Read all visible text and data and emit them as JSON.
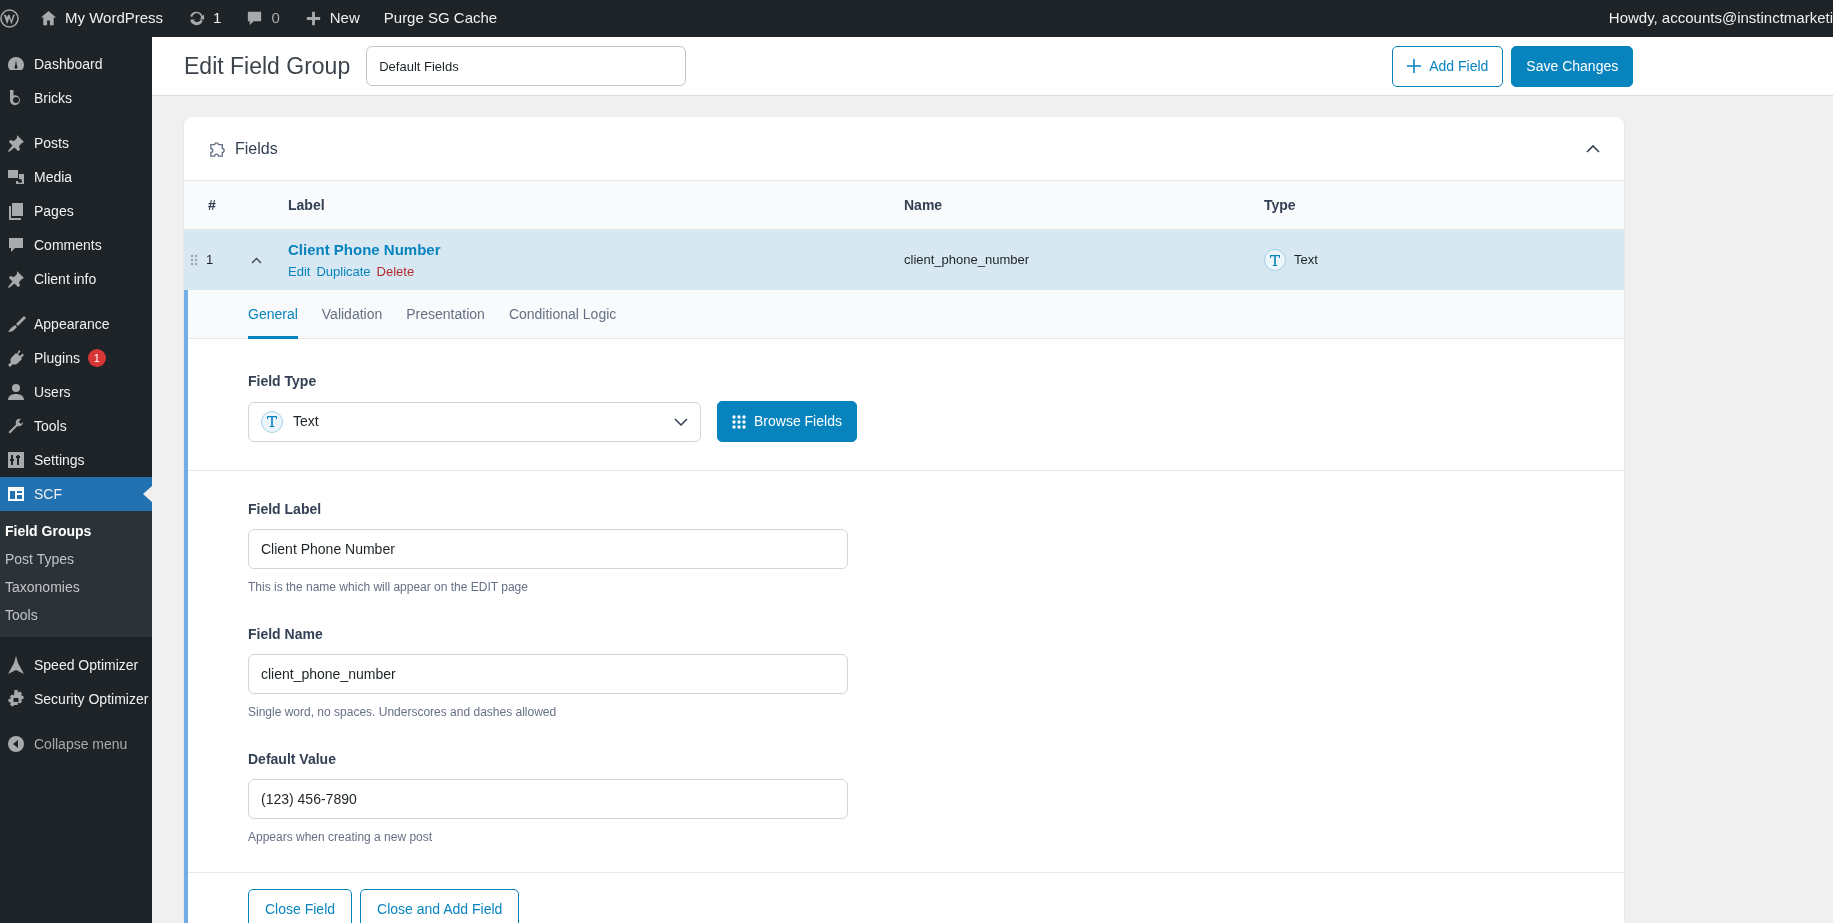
{
  "admin_bar": {
    "items": [
      {
        "kind": "wp-logo"
      },
      {
        "kind": "home",
        "label": "My WordPress"
      },
      {
        "kind": "updates",
        "label": "1"
      },
      {
        "kind": "comments",
        "label": "0"
      },
      {
        "kind": "plus",
        "label": "New"
      },
      {
        "kind": "plain",
        "label": "Purge SG Cache"
      }
    ],
    "greeting": "Howdy, accounts@instinctmarketi"
  },
  "sidebar": {
    "groups": [
      [
        {
          "kind": "dashboard",
          "label": "Dashboard",
          "selected": false
        },
        {
          "kind": "bricks",
          "label": "Bricks",
          "selected": false
        }
      ],
      [
        {
          "kind": "pin",
          "label": "Posts",
          "selected": false
        },
        {
          "kind": "media",
          "label": "Media",
          "selected": false
        },
        {
          "kind": "pages",
          "label": "Pages",
          "selected": false
        },
        {
          "kind": "comment",
          "label": "Comments",
          "selected": false
        },
        {
          "kind": "pin",
          "label": "Client info",
          "selected": false
        }
      ],
      [
        {
          "kind": "brush",
          "label": "Appearance",
          "selected": false
        },
        {
          "kind": "plug",
          "label": "Plugins",
          "selected": false,
          "badge": "1"
        },
        {
          "kind": "user",
          "label": "Users",
          "selected": false
        },
        {
          "kind": "wrench",
          "label": "Tools",
          "selected": false
        },
        {
          "kind": "sliders",
          "label": "Settings",
          "selected": false
        },
        {
          "kind": "table",
          "label": "SCF",
          "selected": true,
          "children": [
            {
              "label": "Field Groups",
              "selected": true
            },
            {
              "label": "Post Types",
              "selected": false
            },
            {
              "label": "Taxonomies",
              "selected": false
            },
            {
              "label": "Tools",
              "selected": false
            }
          ]
        }
      ],
      [
        {
          "kind": "speed",
          "label": "Speed Optimizer",
          "selected": false
        },
        {
          "kind": "shield",
          "label": "Security Optimizer",
          "selected": false
        }
      ]
    ],
    "collapse": "Collapse menu"
  },
  "header": {
    "title": "Edit Field Group",
    "title_value": "Default Fields",
    "buttons": [
      {
        "kind": "outline",
        "label": "Add Field"
      },
      {
        "kind": "primary",
        "label": "Save Changes"
      }
    ]
  },
  "panel": {
    "title": "Fields",
    "expanded": true,
    "table": {
      "columns": [
        "#",
        "Label",
        "Name",
        "Type"
      ],
      "rows": [
        {
          "order": "1",
          "label": "Client Phone Number",
          "name": "client_phone_number",
          "type": "Text",
          "expanded": true,
          "actions": [
            {
              "kind": "link",
              "label": "Edit"
            },
            {
              "kind": "link",
              "label": "Duplicate"
            },
            {
              "kind": "danger",
              "label": "Delete"
            }
          ]
        }
      ]
    },
    "tabs": [
      {
        "label": "General",
        "selected": true
      },
      {
        "label": "Validation",
        "selected": false
      },
      {
        "label": "Presentation",
        "selected": false
      },
      {
        "label": "Conditional Logic",
        "selected": false
      }
    ],
    "field_type": {
      "label": "Field Type",
      "value": "Text",
      "browse_button": "Browse Fields"
    },
    "settings": [
      {
        "label": "Field Label",
        "value": "Client Phone Number",
        "help": "This is the name which will appear on the EDIT page"
      },
      {
        "label": "Field Name",
        "value": "client_phone_number",
        "help": "Single word, no spaces. Underscores and dashes allowed"
      },
      {
        "label": "Default Value",
        "value": "(123) 456-7890",
        "help": "Appears when creating a new post"
      }
    ],
    "footer_buttons": [
      "Close Field",
      "Close and Add Field"
    ]
  }
}
